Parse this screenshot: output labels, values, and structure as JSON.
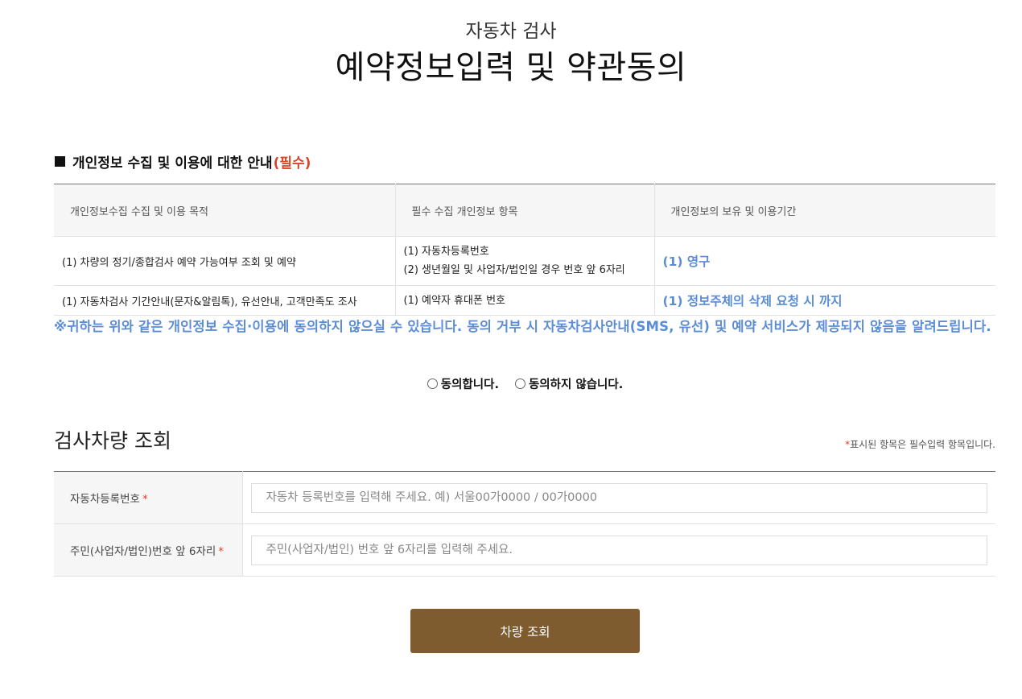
{
  "header": {
    "subtitle": "자동차 검사",
    "title": "예약정보입력 및 약관동의"
  },
  "privacy": {
    "heading": "개인정보 수집 및 이용에 대한 안내",
    "heading_required": "(필수)",
    "columns": [
      "개인정보수집 수집 및 이용 목적",
      "필수 수집 개인정보 항목",
      "개인정보의 보유 및 이용기간"
    ],
    "rows": [
      {
        "purpose": "(1) 차량의 정기/종합검사 예약 가능여부 조회 및 예약",
        "items": [
          "(1) 자동차등록번호",
          "(2) 생년월일 및 사업자/법인일 경우 번호 앞 6자리"
        ],
        "period": "(1) 영구"
      },
      {
        "purpose": "(1) 자동차검사 기간안내(문자&알림톡), 유선안내, 고객만족도 조사",
        "items": [
          "(1) 예약자 휴대폰 번호"
        ],
        "period": "(1) 정보주체의 삭제 요청 시 까지"
      }
    ],
    "notice": "※귀하는 위와 같은 개인정보 수집·이용에 동의하지 않으실 수 있습니다. 동의 거부 시 자동차검사안내(SMS, 유선) 및 예약 서비스가 제공되지 않음을 알려드립니다."
  },
  "consent": {
    "agree_label": "동의합니다.",
    "disagree_label": "동의하지 않습니다."
  },
  "vehicle_search": {
    "title": "검사차량 조회",
    "required_note_star": "*",
    "required_note": "표시된 항목은 필수입력 항목입니다.",
    "fields": [
      {
        "label": "자동차등록번호",
        "star": "*",
        "placeholder": "자동차 등록번호를 입력해 주세요. 예) 서울00가0000 / 00가0000",
        "value": ""
      },
      {
        "label": "주민(사업자/법인)번호 앞 6자리",
        "star": "*",
        "placeholder": "주민(사업자/법인) 번호 앞 6자리를 입력해 주세요.",
        "value": ""
      }
    ],
    "submit_label": "차량 조회"
  },
  "colors": {
    "accent_blue": "#5b8dd6",
    "required_red": "#d9442c",
    "button_brown": "#7f5c30"
  }
}
